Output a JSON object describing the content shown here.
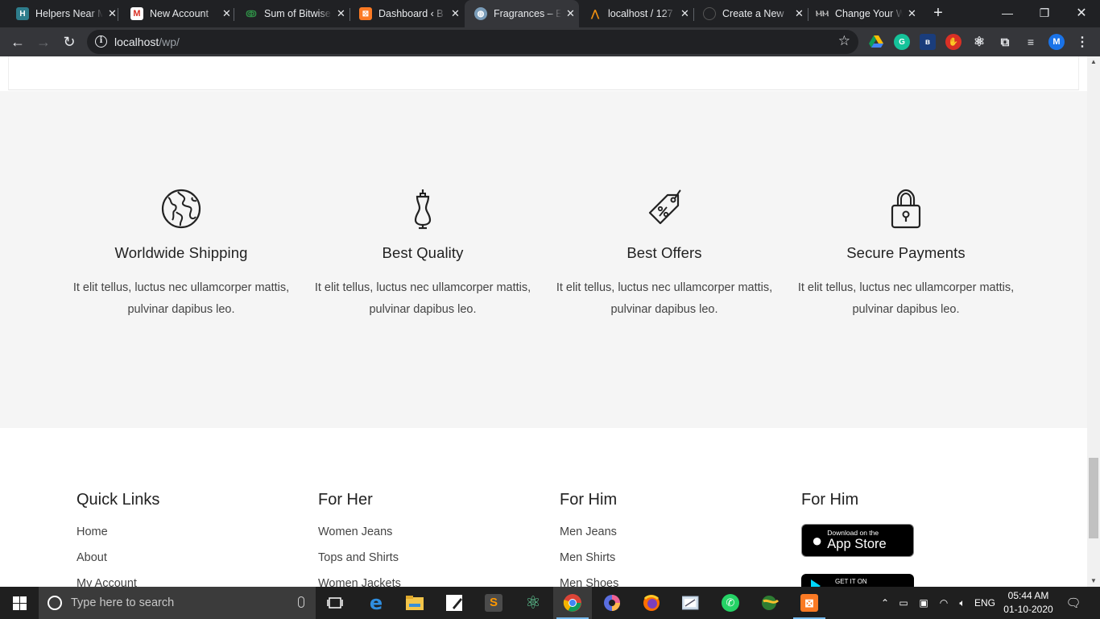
{
  "browser": {
    "tabs": [
      {
        "label": "Helpers Near Me",
        "favicon": "h-icon",
        "active": false
      },
      {
        "label": "New Account",
        "favicon": "gmail-icon",
        "active": false
      },
      {
        "label": "Sum of Bitwise",
        "favicon": "gfg-icon",
        "active": false
      },
      {
        "label": "Dashboard ‹ B",
        "favicon": "xampp-icon",
        "active": false
      },
      {
        "label": "Fragrances – E",
        "favicon": "globe-icon",
        "active": true
      },
      {
        "label": "localhost / 127",
        "favicon": "phpmyadmin-icon",
        "active": false
      },
      {
        "label": "Create a New",
        "favicon": "github-icon",
        "active": false
      },
      {
        "label": "Change Your W",
        "favicon": "mu-icon",
        "active": false
      }
    ],
    "new_tab_symbol": "+",
    "url_host": "localhost",
    "url_path": "/wp/",
    "profile_initial": "M",
    "accent": "#1a73e8"
  },
  "features": [
    {
      "icon": "globe-icon",
      "title": "Worldwide Shipping",
      "text": "It elit tellus, luctus nec ullamcorper mattis, pulvinar dapibus leo."
    },
    {
      "icon": "mannequin-icon",
      "title": "Best Quality",
      "text": "It elit tellus, luctus nec ullamcorper mattis, pulvinar dapibus leo."
    },
    {
      "icon": "price-tag-icon",
      "title": "Best Offers",
      "text": "It elit tellus, luctus nec ullamcorper mattis, pulvinar dapibus leo."
    },
    {
      "icon": "padlock-icon",
      "title": "Secure Payments",
      "text": "It elit tellus, luctus nec ullamcorper mattis, pulvinar dapibus leo."
    }
  ],
  "footer": {
    "columns": [
      {
        "heading": "Quick Links",
        "links": [
          "Home",
          "About",
          "My Account"
        ]
      },
      {
        "heading": "For Her",
        "links": [
          "Women Jeans",
          "Tops and Shirts",
          "Women Jackets"
        ]
      },
      {
        "heading": "For Him",
        "links": [
          "Men Jeans",
          "Men Shirts",
          "Men Shoes"
        ]
      },
      {
        "heading": "For Him",
        "app_store_small": "Download on the",
        "app_store_big": "App Store",
        "google_small": "GET IT ON"
      }
    ]
  },
  "taskbar": {
    "search_placeholder": "Type here to search",
    "language": "ENG",
    "time": "05:44 AM",
    "date": "01-10-2020"
  }
}
